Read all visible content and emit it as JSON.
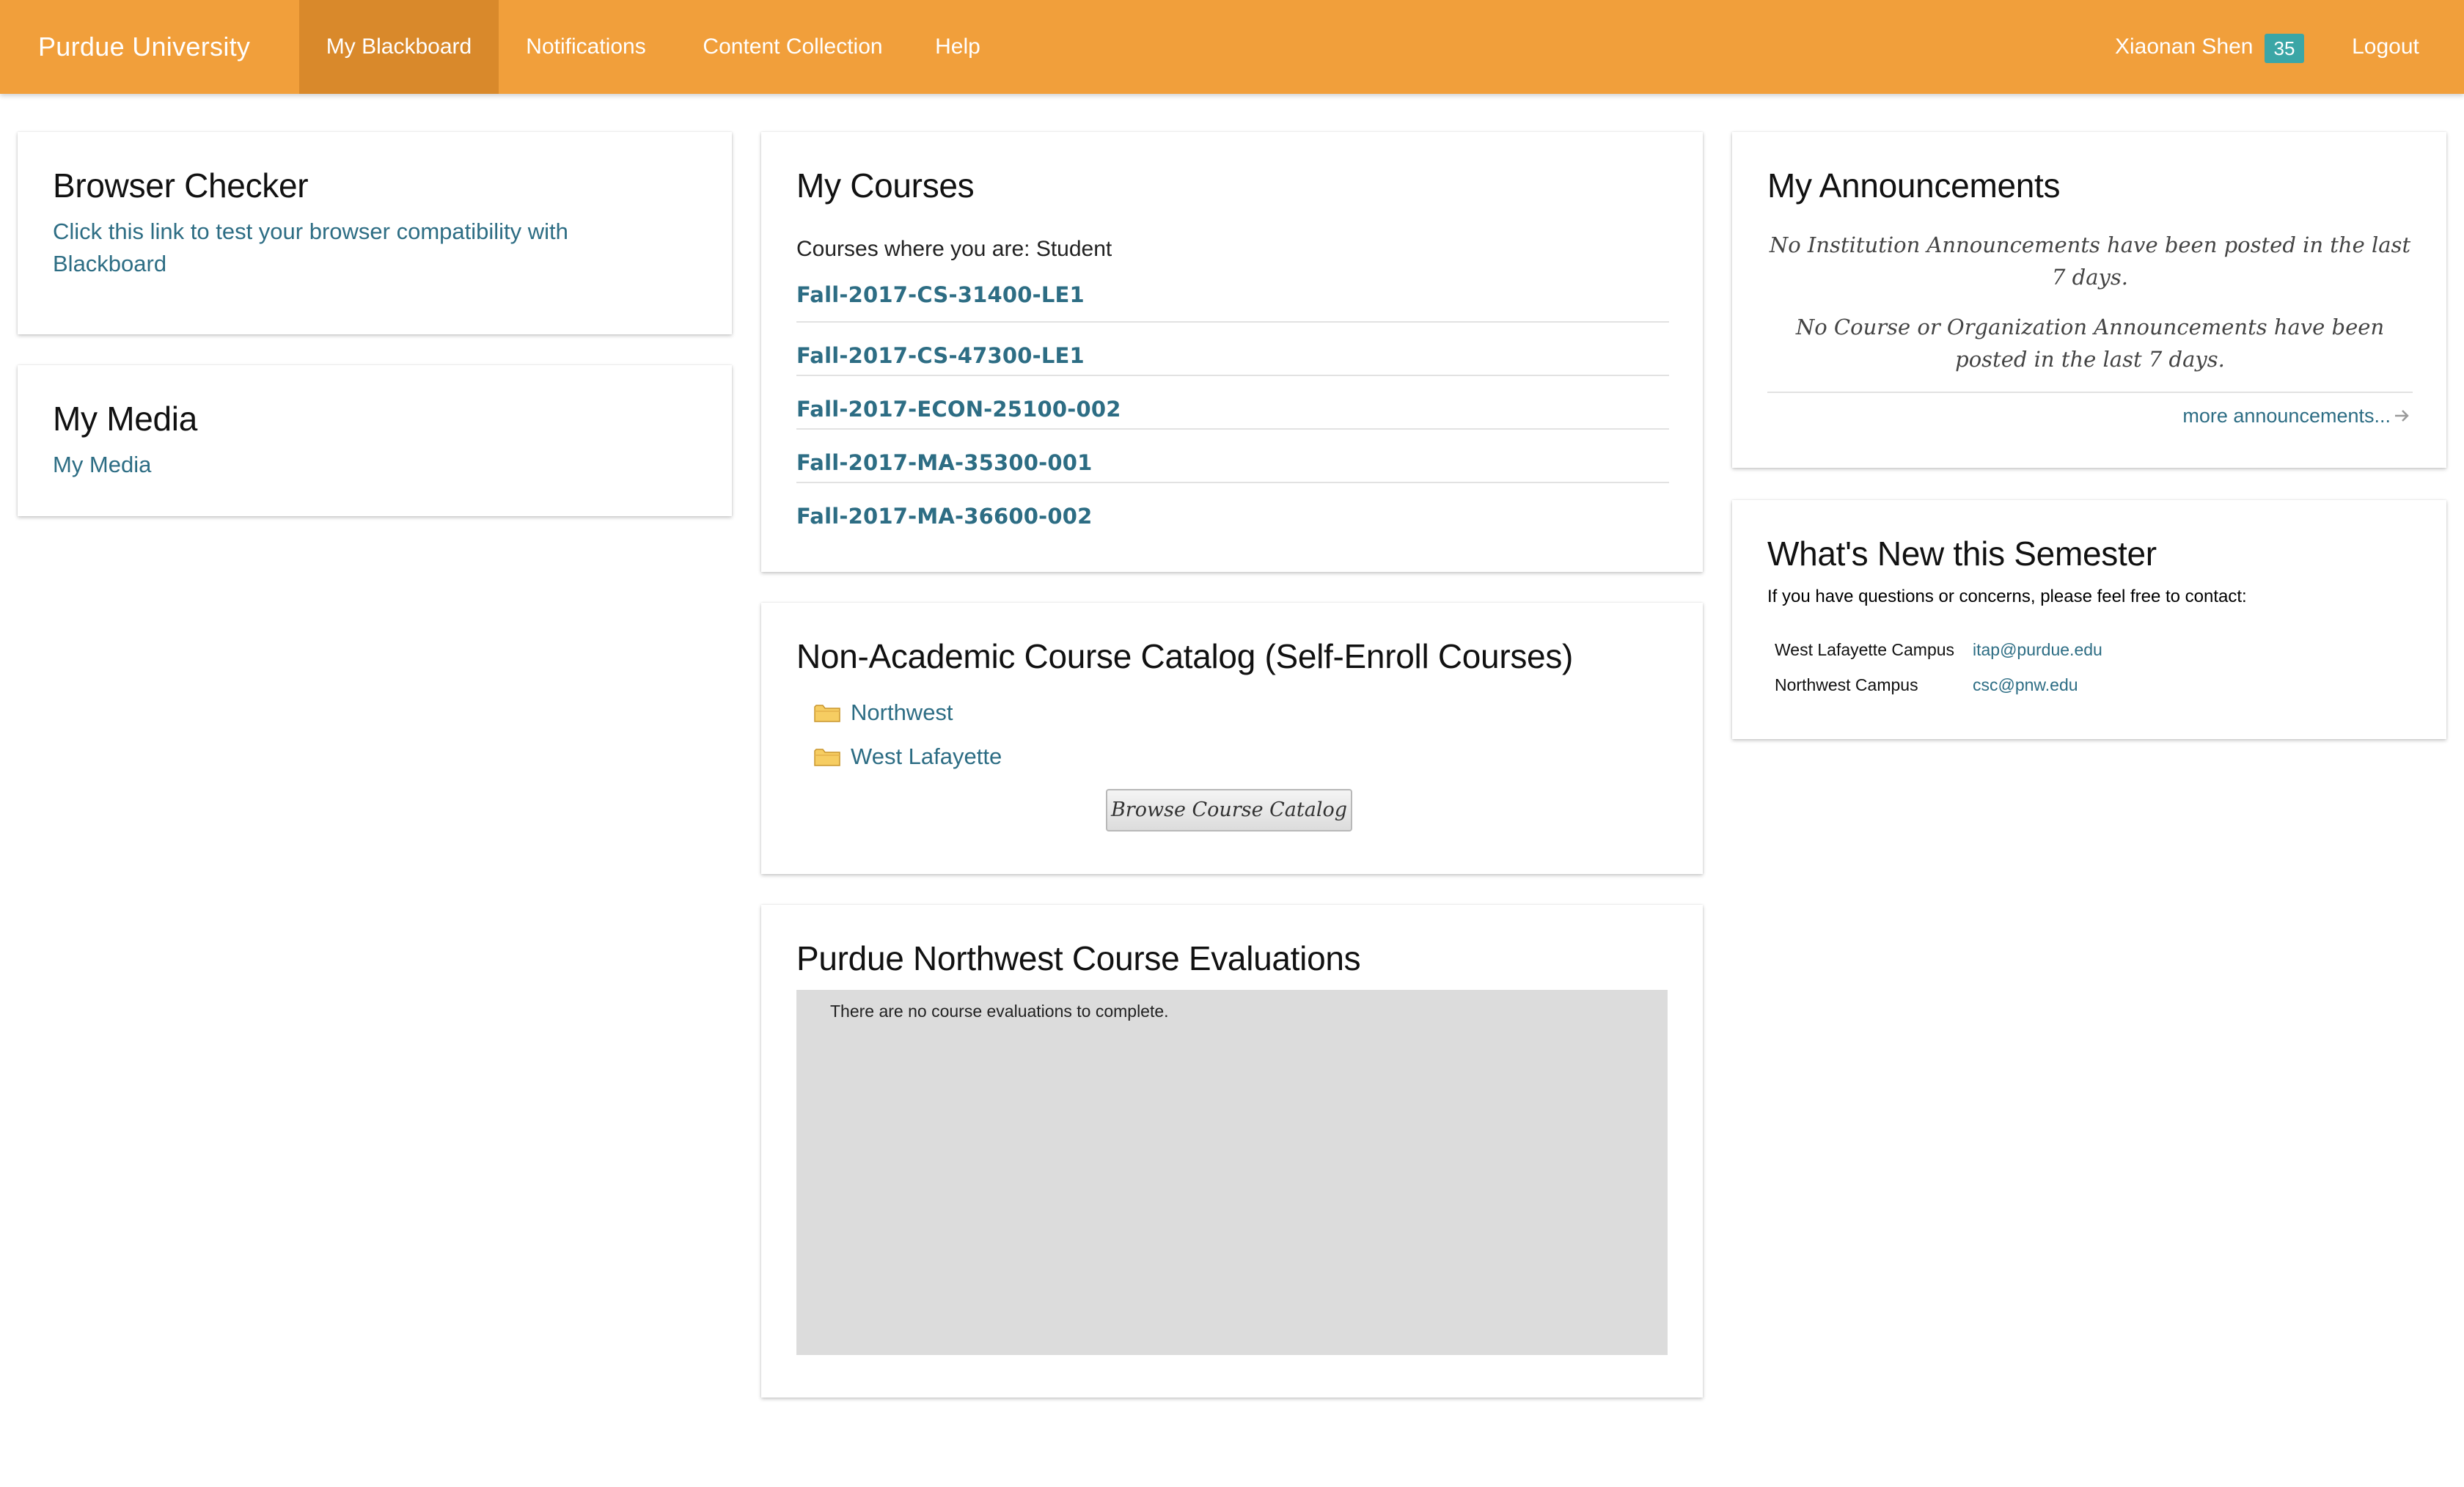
{
  "nav": {
    "brand": "Purdue University",
    "items": [
      {
        "label": "My Blackboard",
        "active": true
      },
      {
        "label": "Notifications",
        "active": false
      },
      {
        "label": "Content Collection",
        "active": false
      },
      {
        "label": "Help",
        "active": false
      }
    ],
    "user_name": "Xiaonan Shen",
    "notification_count": "35",
    "logout_label": "Logout"
  },
  "browser_checker": {
    "title": "Browser Checker",
    "link_text": "Click this link to test your browser compatibility with Blackboard"
  },
  "my_media": {
    "title": "My Media",
    "link_text": "My Media"
  },
  "my_courses": {
    "title": "My Courses",
    "role_text": "Courses where you are: Student",
    "courses": [
      "Fall-2017-CS-31400-LE1",
      "Fall-2017-CS-47300-LE1",
      "Fall-2017-ECON-25100-002",
      "Fall-2017-MA-35300-001",
      "Fall-2017-MA-36600-002"
    ]
  },
  "catalog": {
    "title": "Non-Academic Course Catalog (Self-Enroll Courses)",
    "folders": [
      "Northwest",
      "West Lafayette"
    ],
    "button_label": "Browse Course Catalog"
  },
  "evaluations": {
    "title": "Purdue Northwest Course Evaluations",
    "message": "There are no course evaluations to complete."
  },
  "announcements": {
    "title": "My Announcements",
    "institution_message": "No Institution Announcements have been posted in the last 7 days.",
    "course_message": "No Course or Organization Announcements have been posted in the last 7 days.",
    "more_link": "more announcements..."
  },
  "whats_new": {
    "title": "What's New this Semester",
    "intro": "If you have questions or concerns, please feel free to contact:",
    "contacts": [
      {
        "campus": "West Lafayette Campus",
        "email": "itap@purdue.edu"
      },
      {
        "campus": "Northwest Campus",
        "email": "csc@pnw.edu"
      }
    ]
  },
  "colors": {
    "nav_background": "#f19f3b",
    "nav_active": "#d9892b",
    "badge": "#3ba6a6",
    "link": "#2d6d84",
    "eval_box": "#dcdcdc"
  }
}
